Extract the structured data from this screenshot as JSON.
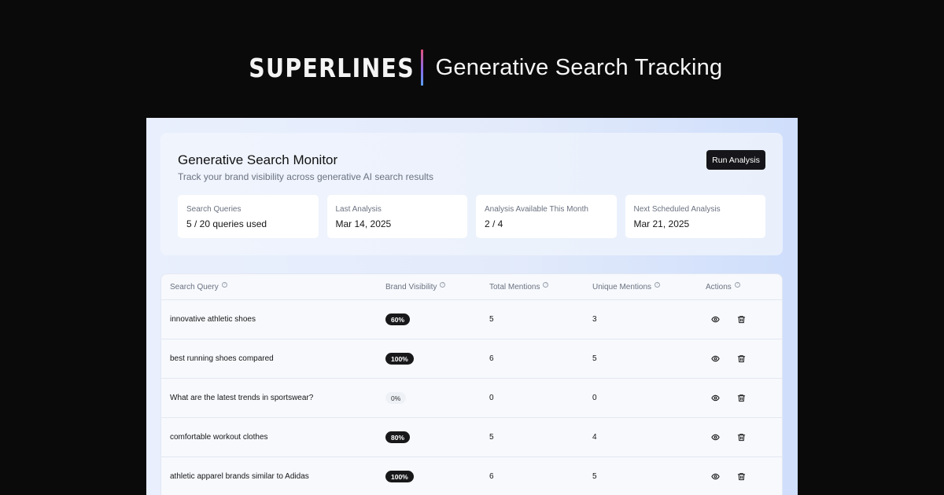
{
  "brand": {
    "logo_text": "SUPERLINES",
    "headline": "Generative Search Tracking"
  },
  "monitor": {
    "title": "Generative Search Monitor",
    "subtitle": "Track your brand visibility across generative AI search results",
    "run_button": "Run Analysis",
    "stats": [
      {
        "label": "Search Queries",
        "value": "5 / 20 queries used"
      },
      {
        "label": "Last Analysis",
        "value": "Mar 14, 2025"
      },
      {
        "label": "Analysis Available This Month",
        "value": "2 / 4"
      },
      {
        "label": "Next Scheduled Analysis",
        "value": "Mar 21, 2025"
      }
    ]
  },
  "table": {
    "headers": [
      "Search Query",
      "Brand Visibility",
      "Total Mentions",
      "Unique Mentions",
      "Actions"
    ],
    "help_glyph": "?",
    "rows": [
      {
        "query": "innovative athletic shoes",
        "visibility": "60%",
        "total": "5",
        "unique": "3"
      },
      {
        "query": "best running shoes compared",
        "visibility": "100%",
        "total": "6",
        "unique": "5"
      },
      {
        "query": "What are the latest trends in sportswear?",
        "visibility": "0%",
        "total": "0",
        "unique": "0"
      },
      {
        "query": "comfortable workout clothes",
        "visibility": "80%",
        "total": "5",
        "unique": "4"
      },
      {
        "query": "athletic apparel brands similar to Adidas",
        "visibility": "100%",
        "total": "6",
        "unique": "5"
      }
    ],
    "action_icons": [
      "eye-icon",
      "trash-icon"
    ]
  },
  "colors": {
    "background": "#0b0a0b",
    "badge_dark": "#18181b",
    "accent_gradient": [
      "#e2507b",
      "#8a6be8",
      "#5aa0f0"
    ]
  }
}
